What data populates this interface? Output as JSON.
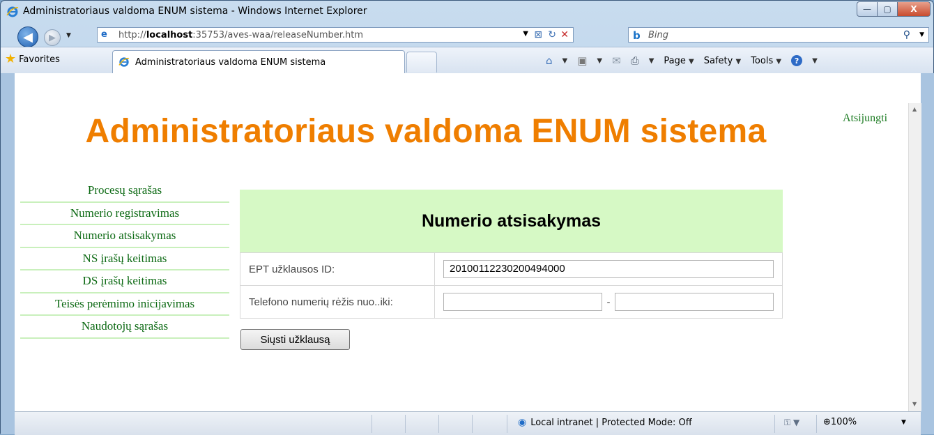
{
  "window": {
    "title": "Administratoriaus valdoma ENUM sistema - Windows Internet Explorer",
    "buttons": {
      "minimize": "—",
      "maximize": "▢",
      "close": "X"
    }
  },
  "navigation": {
    "back_glyph": "◀",
    "forward_glyph": "▶",
    "dropdown_glyph": "▼",
    "url_prefix": "http://",
    "url_host": "localhost",
    "url_rest": ":35753/aves-waa/releaseNumber.htm",
    "search_placeholder": "Bing"
  },
  "favorites_bar": {
    "favorites_label": "Favorites",
    "tab_label": "Administratoriaus valdoma ENUM sistema",
    "page_menu": "Page",
    "safety_menu": "Safety",
    "tools_menu": "Tools",
    "help_glyph": "?"
  },
  "page": {
    "site_title": "Administratoriaus valdoma ENUM sistema",
    "logout": "Atsijungti",
    "menu": [
      {
        "label": "Procesų sąrašas"
      },
      {
        "label": "Numerio registravimas"
      },
      {
        "label": "Numerio atsisakymas"
      },
      {
        "label": "NS įrašų keitimas"
      },
      {
        "label": "DS įrašų keitimas"
      },
      {
        "label": "Teisės perėmimo inicijavimas"
      },
      {
        "label": "Naudotojų sąrašas"
      }
    ],
    "form": {
      "heading": "Numerio atsisakymas",
      "ept_label": "EPT užklausos ID:",
      "ept_value": "20100112230200494000",
      "range_label": "Telefono numerių rėžis nuo..iki:",
      "range_from": "",
      "range_to": "",
      "range_sep": "-",
      "submit": "Siųsti užklausą"
    }
  },
  "statusbar": {
    "zone": "Local intranet | Protected Mode: Off",
    "zoom": "100%"
  },
  "icons": [
    "ie-logo-icon",
    "back-icon",
    "forward-icon",
    "page-icon",
    "compat-view-icon",
    "refresh-icon",
    "stop-icon",
    "bing-icon",
    "search-icon",
    "favorites-star-icon",
    "home-icon",
    "rss-icon",
    "mail-icon",
    "print-icon",
    "help-icon",
    "globe-icon",
    "zoom-icon"
  ]
}
